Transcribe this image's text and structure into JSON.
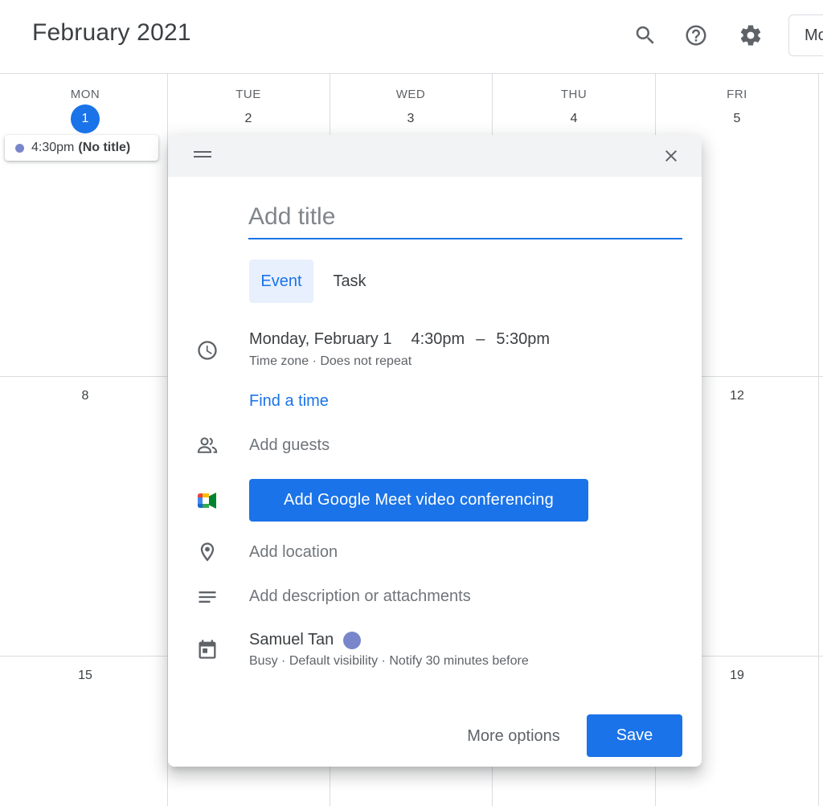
{
  "header": {
    "month_title": "February 2021",
    "view_button_label": "Mo",
    "icons": [
      "search-icon",
      "help-icon",
      "settings-icon"
    ]
  },
  "week1": {
    "days": [
      {
        "dow": "MON",
        "date": "1",
        "today": true
      },
      {
        "dow": "TUE",
        "date": "2"
      },
      {
        "dow": "WED",
        "date": "3"
      },
      {
        "dow": "THU",
        "date": "4"
      },
      {
        "dow": "FRI",
        "date": "5"
      }
    ],
    "event_chip": {
      "time": "4:30pm",
      "title": "(No title)",
      "color": "#7986cb"
    }
  },
  "week2": {
    "dates": [
      "8",
      "12"
    ]
  },
  "week3": {
    "dates": [
      "15",
      "19"
    ]
  },
  "dialog": {
    "title_placeholder": "Add title",
    "tabs": [
      {
        "label": "Event",
        "active": true
      },
      {
        "label": "Task",
        "active": false
      }
    ],
    "datetime": {
      "date": "Monday, February 1",
      "start": "4:30pm",
      "separator": "–",
      "end": "5:30pm",
      "time_zone": "Time zone",
      "dot": "·",
      "repeat": "Does not repeat"
    },
    "find_time": "Find a time",
    "add_guests": "Add guests",
    "meet_button": "Add Google Meet video conferencing",
    "add_location": "Add location",
    "add_description": "Add description or attachments",
    "calendar": {
      "owner": "Samuel Tan",
      "color": "#7986cb",
      "busy": "Busy",
      "visibility": "Default visibility",
      "notify": "Notify 30 minutes before",
      "dot": "·"
    },
    "more_options": "More options",
    "save": "Save"
  },
  "colors": {
    "accent": "#1a73e8",
    "accent_light": "#e8f0fe",
    "event": "#7986cb",
    "grid_line": "#dadce0"
  }
}
